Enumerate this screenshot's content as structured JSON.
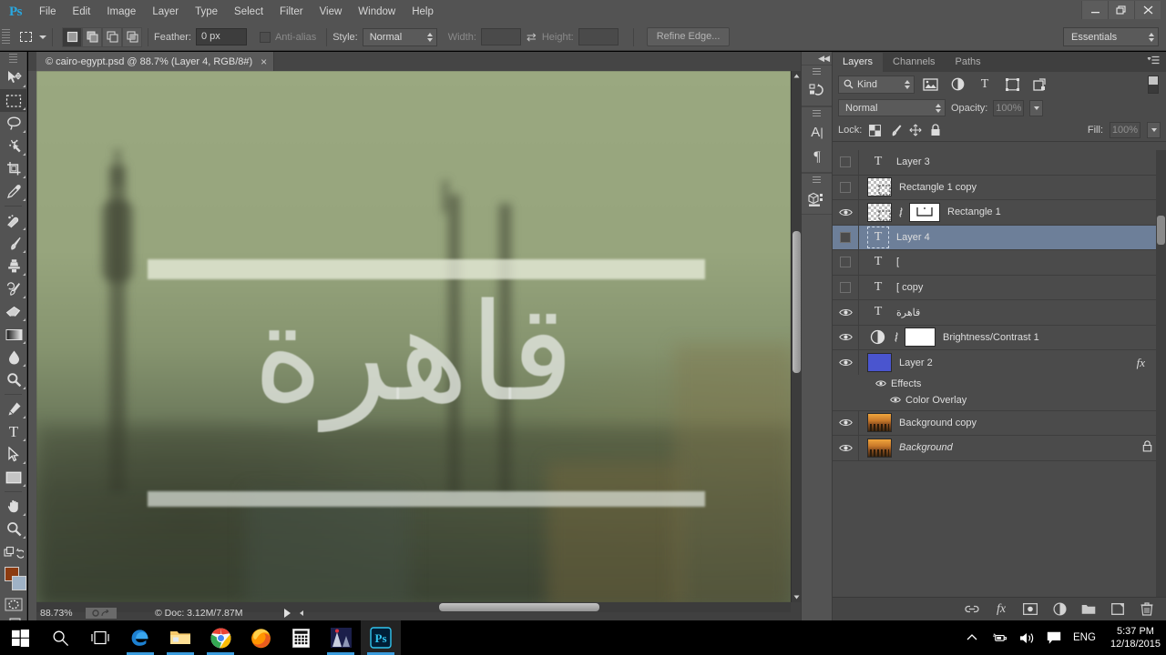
{
  "app": {
    "name": "Ps",
    "menu": [
      "File",
      "Edit",
      "Image",
      "Layer",
      "Type",
      "Select",
      "Filter",
      "View",
      "Window",
      "Help"
    ],
    "window_controls": [
      "minimize",
      "restore",
      "close"
    ]
  },
  "options_bar": {
    "tool": "rectangular-marquee",
    "feather_label": "Feather:",
    "feather_value": "0 px",
    "antialias_label": "Anti-alias",
    "style_label": "Style:",
    "style_value": "Normal",
    "width_label": "Width:",
    "width_value": "",
    "height_label": "Height:",
    "height_value": "",
    "refine_edge": "Refine Edge...",
    "workspace": "Essentials"
  },
  "document": {
    "tab_title": "© cairo-egypt.psd @ 88.7% (Layer 4, RGB/8#)",
    "close_label": "×",
    "canvas_text": "قاهرة"
  },
  "status_bar": {
    "zoom": "88.73%",
    "doc_label": "© Doc:",
    "doc_size": "3.12M/7.87M"
  },
  "tools": [
    {
      "name": "move-tool",
      "selected": false
    },
    {
      "name": "rectangular-marquee-tool",
      "selected": true
    },
    {
      "name": "lasso-tool",
      "selected": false
    },
    {
      "name": "magic-wand-tool",
      "selected": false
    },
    {
      "name": "crop-tool",
      "selected": false
    },
    {
      "name": "eyedropper-tool",
      "selected": false
    },
    {
      "name": "healing-brush-tool",
      "selected": false
    },
    {
      "name": "brush-tool",
      "selected": false
    },
    {
      "name": "clone-stamp-tool",
      "selected": false
    },
    {
      "name": "history-brush-tool",
      "selected": false
    },
    {
      "name": "eraser-tool",
      "selected": false
    },
    {
      "name": "gradient-tool",
      "selected": false
    },
    {
      "name": "blur-tool",
      "selected": false
    },
    {
      "name": "dodge-tool",
      "selected": false
    },
    {
      "name": "pen-tool",
      "selected": false
    },
    {
      "name": "horizontal-type-tool",
      "selected": false
    },
    {
      "name": "path-selection-tool",
      "selected": false
    },
    {
      "name": "rectangle-tool",
      "selected": false
    },
    {
      "name": "hand-tool",
      "selected": false
    },
    {
      "name": "zoom-tool",
      "selected": false
    }
  ],
  "color_swatches": {
    "foreground": "#8c3b10",
    "background": "#9fb2c6"
  },
  "rail": {
    "collapse_label": "◀◀",
    "buttons": [
      "history-icon",
      "character-icon",
      "paragraph-icon",
      "3d-icon"
    ]
  },
  "layers_panel": {
    "tabs": [
      {
        "label": "Layers",
        "active": true
      },
      {
        "label": "Channels",
        "active": false
      },
      {
        "label": "Paths",
        "active": false
      }
    ],
    "filter": {
      "kind_label": "Kind",
      "icons": [
        "pixel-filter-icon",
        "adjustment-filter-icon",
        "type-filter-icon",
        "shape-filter-icon",
        "smartobject-filter-icon"
      ]
    },
    "blend_mode": "Normal",
    "opacity_label": "Opacity:",
    "opacity_value": "100%",
    "lock_label": "Lock:",
    "lock_icons": [
      "lock-transparent-icon",
      "lock-image-icon",
      "lock-position-icon",
      "lock-all-icon"
    ],
    "fill_label": "Fill:",
    "fill_value": "100%",
    "layers": [
      {
        "name": "Layer 3",
        "visible": false,
        "selected": false,
        "thumb": "type",
        "italic": false
      },
      {
        "name": "Rectangle 1 copy",
        "visible": false,
        "selected": false,
        "thumb": "shape",
        "italic": false
      },
      {
        "name": "Rectangle 1",
        "visible": true,
        "selected": false,
        "thumb": "shape-mask",
        "italic": false
      },
      {
        "name": "Layer 4",
        "visible": false,
        "selected": true,
        "thumb": "type-boxed",
        "italic": false
      },
      {
        "name": "[",
        "visible": false,
        "selected": false,
        "thumb": "type",
        "italic": false
      },
      {
        "name": "[ copy",
        "visible": false,
        "selected": false,
        "thumb": "type",
        "italic": false
      },
      {
        "name": "قاهرة",
        "visible": true,
        "selected": false,
        "thumb": "type",
        "italic": false
      },
      {
        "name": "Brightness/Contrast 1",
        "visible": true,
        "selected": false,
        "thumb": "adjustment",
        "italic": false
      },
      {
        "name": "Layer 2",
        "visible": true,
        "selected": false,
        "thumb": "solid",
        "italic": false,
        "fx": "fx",
        "effects": {
          "label": "Effects",
          "items": [
            "Color Overlay"
          ]
        }
      },
      {
        "name": "Background copy",
        "visible": true,
        "selected": false,
        "thumb": "city",
        "italic": false
      },
      {
        "name": "Background",
        "visible": true,
        "selected": false,
        "thumb": "city",
        "italic": true,
        "locked": true
      }
    ],
    "bottom_buttons": [
      "link-layers-icon",
      "layer-style-fx-icon",
      "add-mask-icon",
      "adjustment-layer-icon",
      "new-group-icon",
      "new-layer-icon",
      "delete-layer-icon"
    ]
  },
  "taskbar": {
    "items": [
      {
        "name": "start-button",
        "icon": "windows-icon"
      },
      {
        "name": "search-button",
        "icon": "search-icon"
      },
      {
        "name": "task-view-button",
        "icon": "taskview-icon"
      },
      {
        "name": "edge-button",
        "icon": "edge-icon"
      },
      {
        "name": "file-explorer-button",
        "icon": "folder-icon"
      },
      {
        "name": "chrome-button",
        "icon": "chrome-icon"
      },
      {
        "name": "firefox-button",
        "icon": "firefox-icon"
      },
      {
        "name": "calculator-button",
        "icon": "calculator-icon"
      },
      {
        "name": "app-button",
        "icon": "app-icon"
      },
      {
        "name": "photoshop-button",
        "icon": "photoshop-icon"
      }
    ],
    "tray": {
      "show_hidden": "^",
      "icons": [
        "network-icon",
        "volume-icon",
        "action-center-icon"
      ],
      "language": "ENG",
      "time": "5:37 PM",
      "date": "12/18/2015"
    }
  }
}
